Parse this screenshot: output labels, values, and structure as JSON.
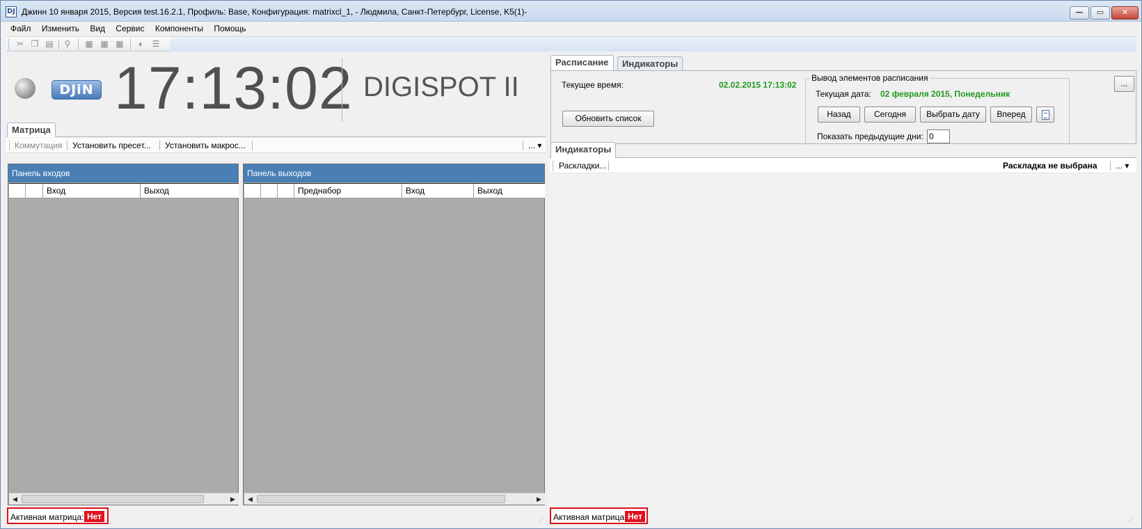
{
  "window": {
    "title": "Джинн 10 января 2015, Версия test.16.2.1, Профиль: Base, Конфигурация: matrixcl_1, - Людмила, Санкт-Петербург,  License, K5(1)-",
    "icon_text": "DJ",
    "min_symbol": "—",
    "max_symbol": "▭",
    "close_symbol": "✕"
  },
  "menu": [
    "Файл",
    "Изменить",
    "Вид",
    "Сервис",
    "Компоненты",
    "Помощь"
  ],
  "toolbar_icons": [
    "cut-icon",
    "copy-icon",
    "paste-icon",
    "find-icon",
    "layout1-icon",
    "layout2-icon",
    "layout3-icon",
    "speaker-icon",
    "list-icon"
  ],
  "clock": {
    "time": "17:13:02",
    "brand": "DIGISPOT II",
    "logo_text": "DJiN"
  },
  "left": {
    "tab": "Матрица",
    "toolbar": {
      "commutation": "Коммутация",
      "set_preset": "Установить пресет...",
      "set_macro": "Установить макрос...",
      "more": "... ▾"
    },
    "inputs_panel": {
      "title": "Панель входов",
      "columns": [
        "Вход",
        "Выход"
      ]
    },
    "outputs_panel": {
      "title": "Панель выходов",
      "columns": [
        "Преднабор",
        "Вход",
        "Выход"
      ]
    },
    "status": {
      "label": "Активная матрица:",
      "value": "Нет"
    }
  },
  "right": {
    "tabs": [
      "Расписание",
      "Индикаторы"
    ],
    "schedule": {
      "current_time_label": "Текущее время:",
      "current_time_value": "02.02.2015 17:13:02",
      "refresh_button": "Обновить список",
      "group_title": "Вывод элементов расписания",
      "current_date_label": "Текущая дата:",
      "current_date_value": "02 февраля 2015, Понедельник",
      "back_button": "Назад",
      "today_button": "Сегодня",
      "pick_date_button": "Выбрать дату",
      "forward_button": "Вперед",
      "prev_days_label": "Показать предыдущие дни:",
      "prev_days_value": "0",
      "more_button": "..."
    },
    "indicators": {
      "tab": "Индикаторы",
      "layouts_button": "Раскладки...",
      "layout_status": "Раскладка не выбрана",
      "more": "... ▾"
    },
    "status": {
      "label": "Активная матрица:",
      "value": "Нет"
    }
  }
}
